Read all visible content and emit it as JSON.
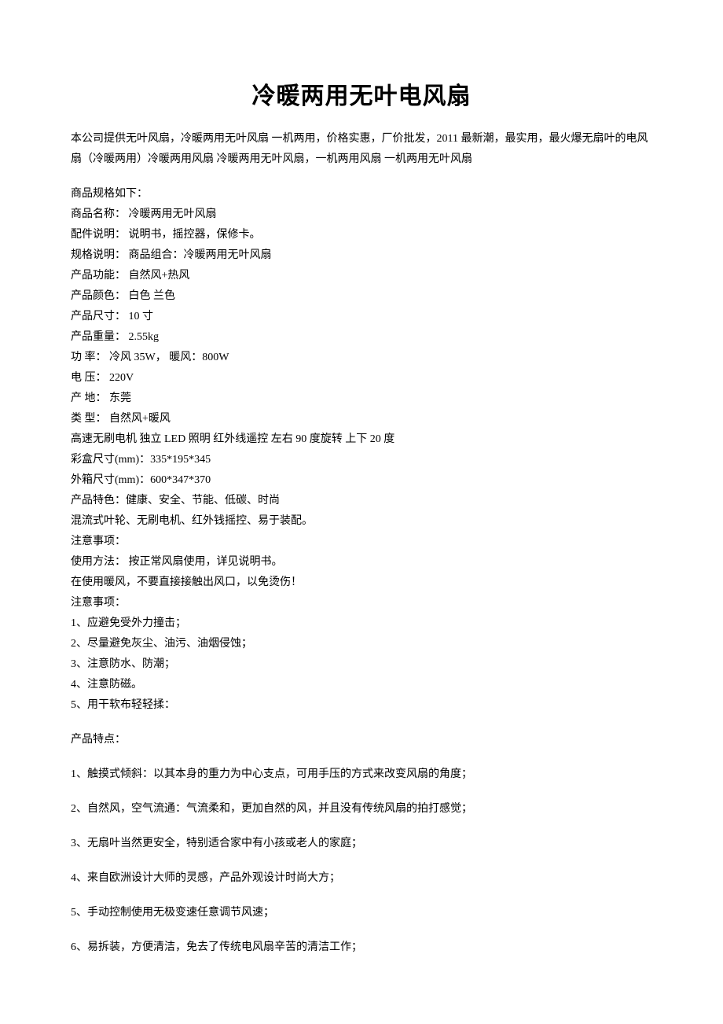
{
  "title": "冷暖两用无叶电风扇",
  "intro": "本公司提供无叶风扇，冷暖两用无叶风扇 一机两用，价格实惠，厂价批发，2011 最新潮，最实用，最火爆无扇叶的电风扇（冷暖两用）冷暖两用风扇 冷暖两用无叶风扇，一机两用风扇   一机两用无叶风扇",
  "specs_header": "商品规格如下：",
  "spec_lines": [
    "商品名称：  冷暖两用无叶风扇",
    "配件说明：  说明书，摇控器，保修卡。",
    "规格说明：  商品组合：冷暖两用无叶风扇",
    "产品功能：  自然风+热风",
    "产品颜色：  白色 兰色",
    "产品尺寸：  10 寸",
    "产品重量：  2.55kg",
    "功  率：         冷风 35W，  暖风：800W",
    "电  压：         220V",
    "产  地：         东莞",
    "类  型：         自然风+暖风",
    "高速无刷电机  独立 LED 照明  红外线遥控  左右 90 度旋转  上下 20 度",
    "彩盒尺寸(mm)：335*195*345",
    "外箱尺寸(mm)：600*347*370",
    "产品特色：健康、安全、节能、低碳、时尚",
    "混流式叶轮、无刷电机、红外钱摇控、易于装配。",
    "注意事项：",
    "使用方法：  按正常风扇使用，详见说明书。",
    "在使用暖风，不要直接接触出风口，以免烫伤！",
    "注意事项：",
    "1、应避免受外力撞击；",
    "2、尽量避免灰尘、油污、油烟侵蚀；",
    "3、注意防水、防潮；",
    "4、注意防磁。",
    "5、用干软布轻轻揉："
  ],
  "features_header": "产品特点：",
  "feature_lines": [
    "1、触摸式倾斜：以其本身的重力为中心支点，可用手压的方式来改变风扇的角度；",
    "2、自然风，空气流通：气流柔和，更加自然的风，并且没有传统风扇的拍打感觉；",
    "3、无扇叶当然更安全，特别适合家中有小孩或老人的家庭；",
    "4、来自欧洲设计大师的灵感，产品外观设计时尚大方；",
    "5、手动控制使用无极变速任意调节风速；",
    "6、易拆装，方便清洁，免去了传统电风扇辛苦的清洁工作；"
  ]
}
